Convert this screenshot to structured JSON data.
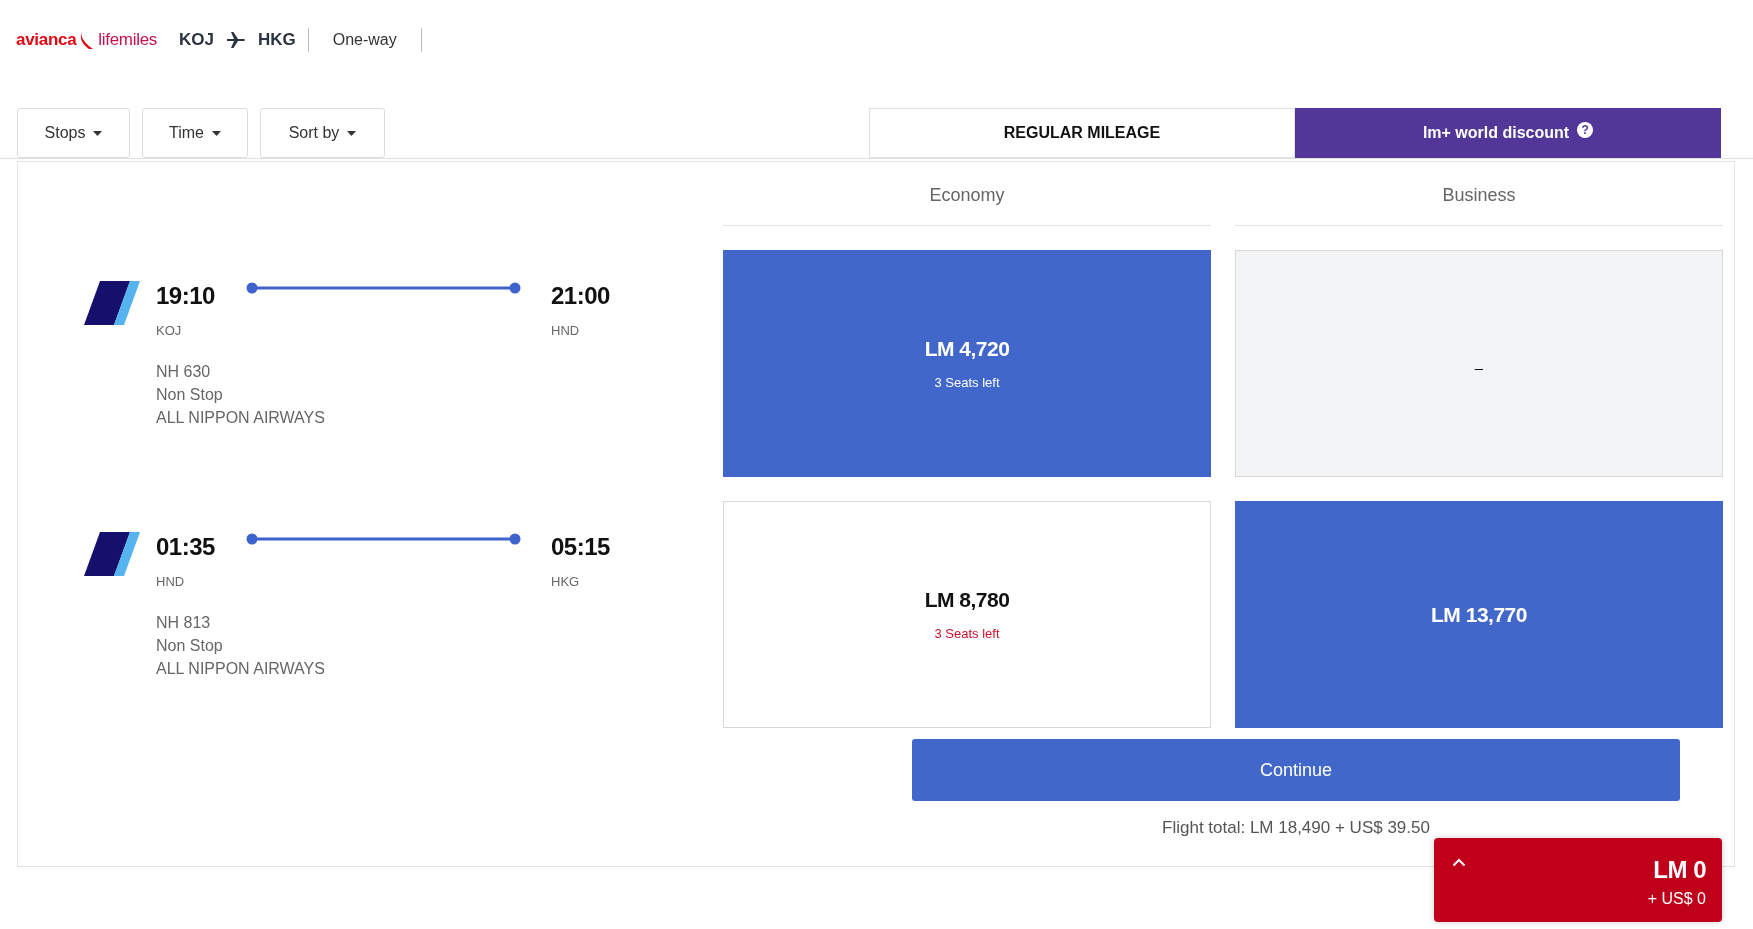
{
  "header": {
    "logo": {
      "brand": "avianca",
      "program": "lifemiles"
    },
    "origin": "KOJ",
    "destination": "HKG",
    "trip_type": "One-way"
  },
  "filters": [
    {
      "label": "Stops"
    },
    {
      "label": "Time"
    },
    {
      "label": "Sort by"
    }
  ],
  "fare_tabs": [
    {
      "label": "REGULAR MILEAGE",
      "selected": false
    },
    {
      "label": "lm+ world discount",
      "selected": true,
      "help": "?"
    }
  ],
  "cabins": [
    {
      "name": "Economy"
    },
    {
      "name": "Business"
    }
  ],
  "flights": [
    {
      "departure_time": "19:10",
      "departure_airport": "KOJ",
      "arrival_time": "21:00",
      "arrival_airport": "HND",
      "flight_number": "NH 630",
      "stops": "Non Stop",
      "airline": "ALL NIPPON AIRWAYS",
      "fares": [
        {
          "kind": "available",
          "price": "LM 4,720",
          "seats": "3 Seats left",
          "selected": true
        },
        {
          "kind": "unavailable",
          "label": "–"
        }
      ]
    },
    {
      "departure_time": "01:35",
      "departure_airport": "HND",
      "arrival_time": "05:15",
      "arrival_airport": "HKG",
      "flight_number": "NH 813",
      "stops": "Non Stop",
      "airline": "ALL NIPPON AIRWAYS",
      "fares": [
        {
          "kind": "available",
          "price": "LM 8,780",
          "seats": "3 Seats left",
          "selected": false
        },
        {
          "kind": "available",
          "price": "LM 13,770",
          "selected": true
        }
      ]
    }
  ],
  "continue_button": "Continue",
  "flight_total": "Flight total: LM 18,490 + US$ 39.50",
  "summary": {
    "miles": "LM 0",
    "cash": "+ US$ 0",
    "expanded": false
  }
}
